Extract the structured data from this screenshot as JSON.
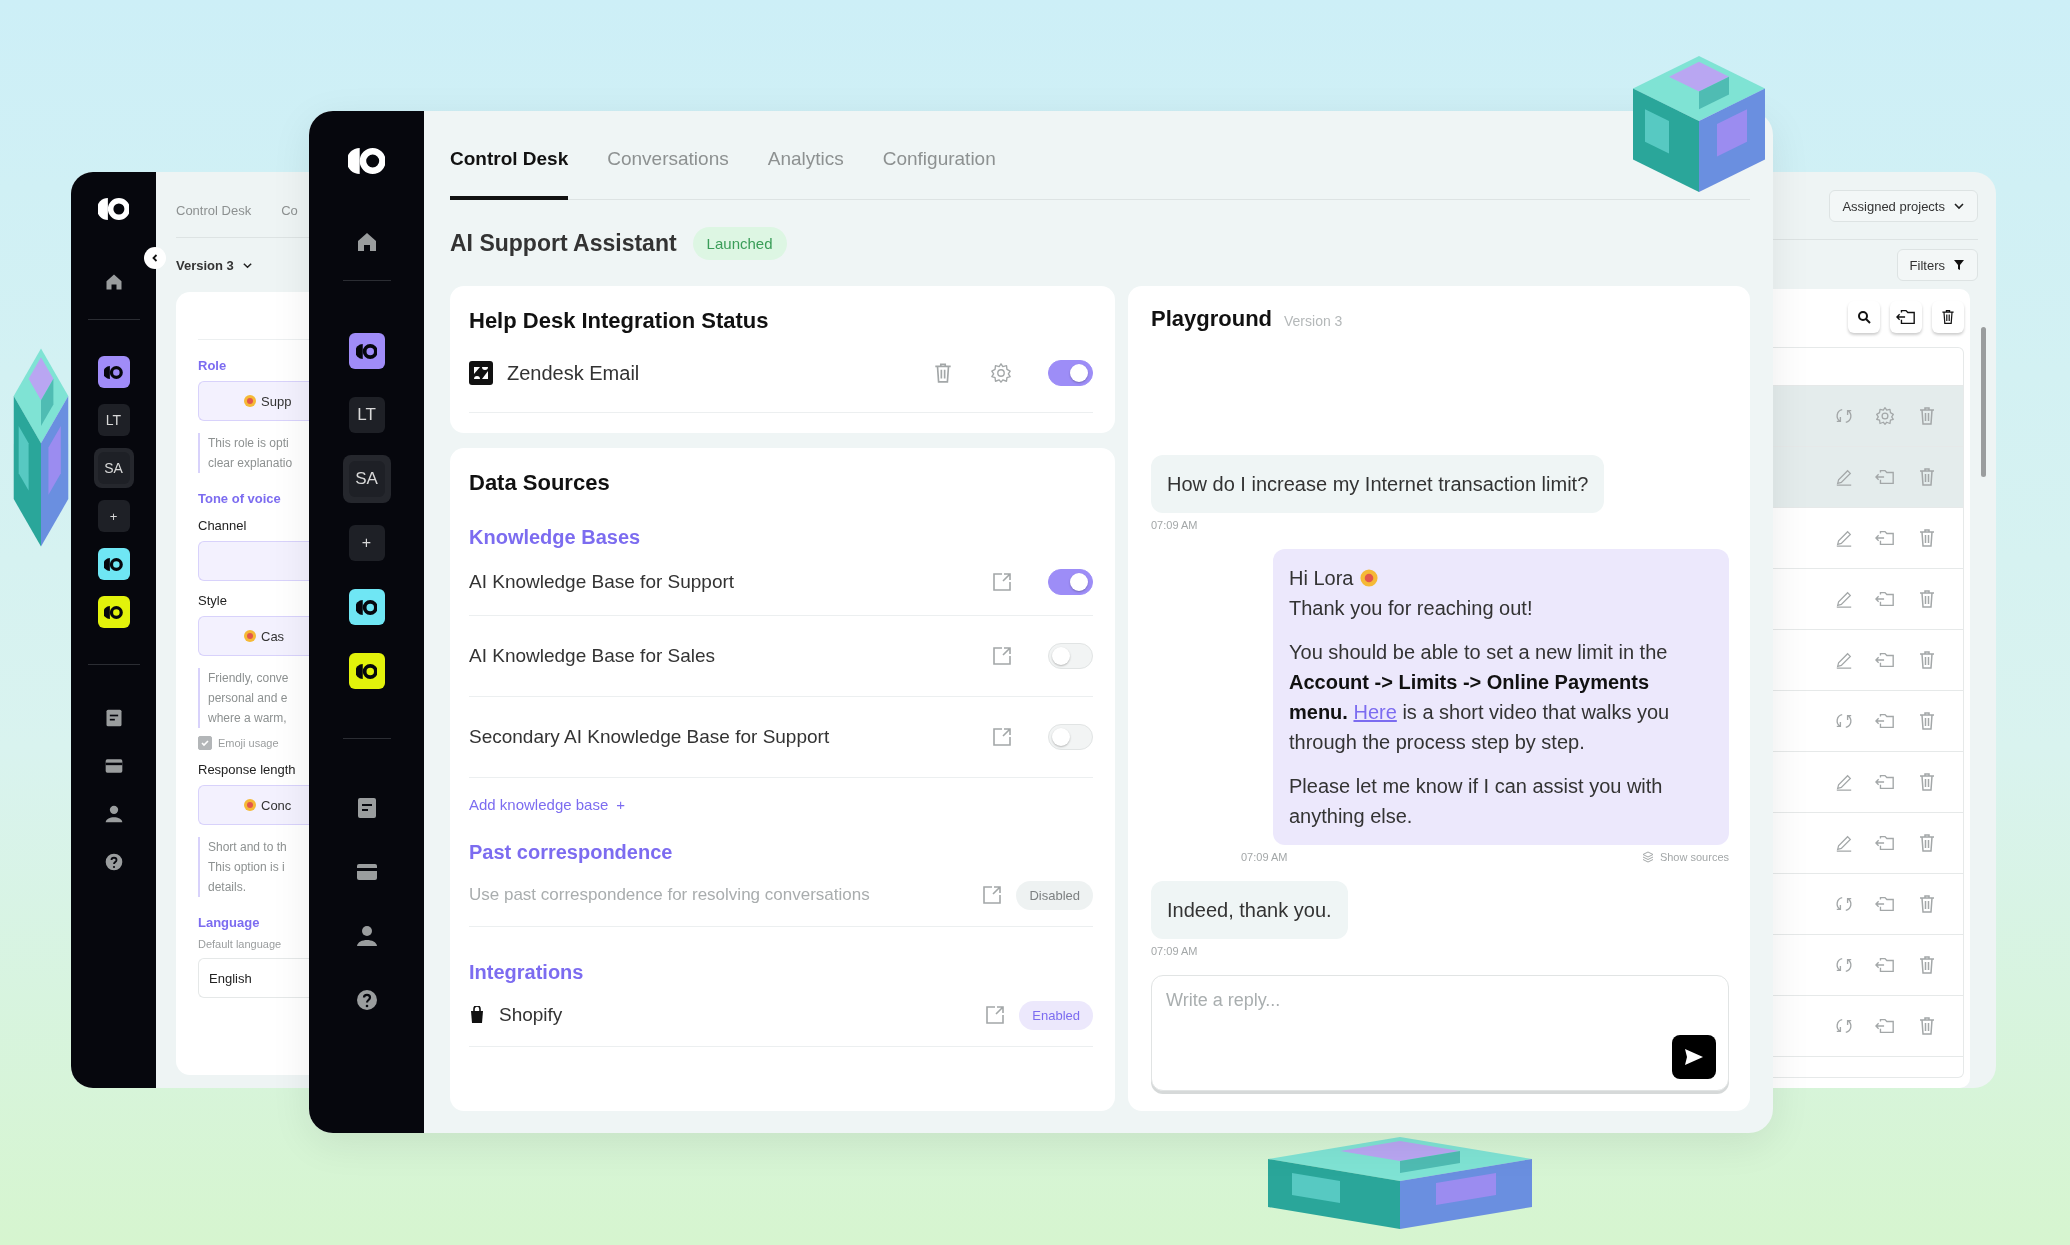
{
  "left_window": {
    "sidebar": {
      "workspaces": [
        {
          "kind": "logo",
          "color": "#a08cf8",
          "selected": false
        },
        {
          "kind": "initials",
          "label": "LT",
          "selected": false
        },
        {
          "kind": "initials",
          "label": "SA",
          "selected": true
        },
        {
          "kind": "add",
          "label": "+",
          "selected": false
        },
        {
          "kind": "logo",
          "color": "#6fe6f4",
          "selected": false
        },
        {
          "kind": "logo",
          "color": "#e2f20b",
          "selected": false
        }
      ]
    },
    "tabs": [
      "Control Desk",
      "Co"
    ],
    "version": "Version 3",
    "form": [
      {
        "kind": "heading",
        "text": "Role"
      },
      {
        "kind": "select",
        "emoji": true,
        "text": "Supp"
      },
      {
        "kind": "note",
        "lines": [
          "This role is opti",
          "clear explanatio"
        ]
      },
      {
        "kind": "heading",
        "text": "Tone of voice"
      },
      {
        "kind": "label",
        "text": "Channel"
      },
      {
        "kind": "select",
        "emoji": false
      },
      {
        "kind": "label",
        "text": "Style"
      },
      {
        "kind": "select",
        "emoji": true,
        "text": "Cas"
      },
      {
        "kind": "note",
        "lines": [
          "Friendly, conve",
          "personal and e",
          "where a warm,"
        ]
      },
      {
        "kind": "checkbox",
        "text": "Emoji usage",
        "checked": true
      },
      {
        "kind": "label",
        "text": "Response length"
      },
      {
        "kind": "select",
        "emoji": true,
        "text": "Conc"
      },
      {
        "kind": "note",
        "lines": [
          "Short and to th",
          "This option is i",
          "details."
        ]
      },
      {
        "kind": "heading",
        "text": "Language"
      },
      {
        "kind": "hint",
        "text": "Default language"
      },
      {
        "kind": "input",
        "text": "English"
      }
    ]
  },
  "main_window": {
    "sidebar": {
      "workspaces": [
        {
          "kind": "logo",
          "color": "#a08cf8",
          "selected": false
        },
        {
          "kind": "initials",
          "label": "LT",
          "selected": false
        },
        {
          "kind": "initials",
          "label": "SA",
          "selected": true
        },
        {
          "kind": "add",
          "label": "+",
          "selected": false
        },
        {
          "kind": "logo",
          "color": "#6fe6f4",
          "selected": false
        },
        {
          "kind": "logo",
          "color": "#e2f20b",
          "selected": false
        }
      ]
    },
    "tabs": [
      {
        "label": "Control Desk",
        "selected": true
      },
      {
        "label": "Conversations",
        "selected": false
      },
      {
        "label": "Analytics",
        "selected": false
      },
      {
        "label": "Configuration",
        "selected": false
      }
    ],
    "title": "AI Support Assistant",
    "status": "Launched",
    "help_desk": {
      "title": "Help Desk Integration Status",
      "integrations": [
        {
          "name": "Zendesk Email",
          "on": true
        }
      ]
    },
    "data_sources": {
      "title": "Data Sources",
      "knowledge_bases": {
        "heading": "Knowledge Bases",
        "items": [
          {
            "name": "AI Knowledge Base for Support",
            "on": true
          },
          {
            "name": "AI Knowledge Base for Sales",
            "on": false
          },
          {
            "name": "Secondary AI Knowledge Base for Support",
            "on": false
          }
        ],
        "add_link": "Add knowledge base",
        "add_sign": "+"
      },
      "past_correspondence": {
        "heading": "Past correspondence",
        "description": "Use past correspondence for resolving conversations",
        "status": "Disabled",
        "enabled": false
      },
      "integrations": {
        "heading": "Integrations",
        "items": [
          {
            "name": "Shopify",
            "status": "Enabled",
            "enabled": true
          }
        ]
      }
    },
    "playground": {
      "title": "Playground",
      "version": "Version 3",
      "messages": [
        {
          "kind": "user",
          "text": "How do I increase my Internet transaction limit?",
          "time": "07:09 AM"
        },
        {
          "kind": "bot",
          "greeting": "Hi Lora",
          "intro": "Thank you for reaching out!",
          "before": "You should be able to set a new limit in the **Account -> Limits -> Online Payments menu.**",
          "link": "Here",
          "after": "is a short video that walks you through the process step by step.",
          "closing": "Please let me know if I can assist you with anything else.",
          "time": "07:09 AM",
          "sources": "Show sources"
        },
        {
          "kind": "user",
          "text": "Indeed, thank you.",
          "time": "07:09 AM"
        }
      ],
      "reply": {
        "placeholder": "Write a reply..."
      }
    }
  },
  "right_window": {
    "projects": "Assigned projects",
    "filters": "Filters",
    "rows": [
      {
        "kind": "sync-settings",
        "selected": true
      },
      {
        "kind": "edit",
        "selected": true
      },
      {
        "kind": "edit",
        "selected": false
      },
      {
        "kind": "edit",
        "selected": false
      },
      {
        "kind": "edit",
        "selected": false
      },
      {
        "kind": "sync",
        "selected": false
      },
      {
        "kind": "edit",
        "selected": false
      },
      {
        "kind": "edit",
        "selected": false
      },
      {
        "kind": "sync",
        "selected": false
      },
      {
        "kind": "sync",
        "selected": false
      },
      {
        "kind": "sync",
        "selected": false
      }
    ]
  }
}
